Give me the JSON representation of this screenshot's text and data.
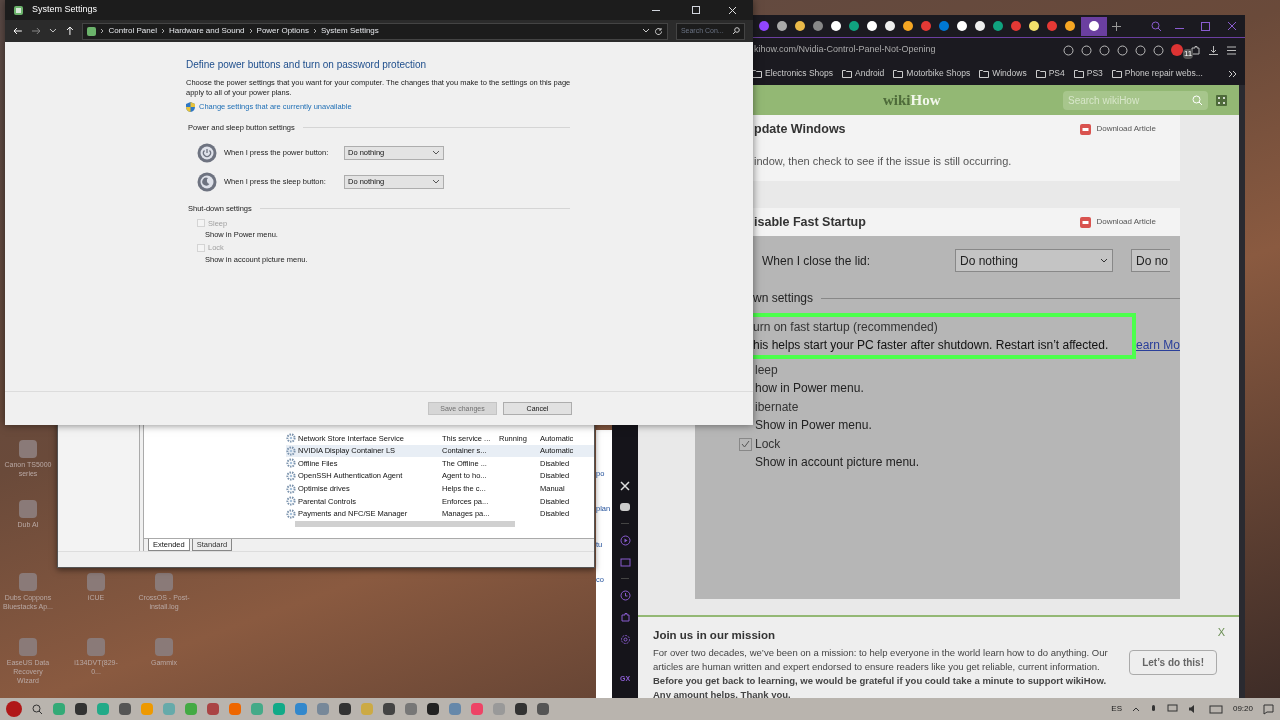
{
  "desktop_icons": [
    {
      "label": "Canon TS5000 series"
    },
    {
      "label": "Dub AI"
    },
    {
      "label": "Dubs Coppons Bluestacks Ap..."
    },
    {
      "label": "iCUE"
    },
    {
      "label": "CrossOS - Post-install.log"
    },
    {
      "label": "EaseUS Data Recovery Wizard"
    },
    {
      "label": "i134DVT(829-0..."
    },
    {
      "label": "Gammix"
    }
  ],
  "services_window": {
    "rows": [
      {
        "cells": [
          "Network Store Interface Service",
          "This service ...",
          "Running",
          "Automatic"
        ],
        "selected": false
      },
      {
        "cells": [
          "NVIDIA Display Container LS",
          "Container s...",
          "",
          "Automatic"
        ],
        "selected": true
      },
      {
        "cells": [
          "Offline Files",
          "The Offline ...",
          "",
          "Disabled"
        ],
        "selected": false
      },
      {
        "cells": [
          "OpenSSH Authentication Agent",
          "Agent to ho...",
          "",
          "Disabled"
        ],
        "selected": false
      },
      {
        "cells": [
          "Optimise drives",
          "Helps the c...",
          "",
          "Manual"
        ],
        "selected": false
      },
      {
        "cells": [
          "Parental Controls",
          "Enforces pa...",
          "",
          "Disabled"
        ],
        "selected": false
      },
      {
        "cells": [
          "Payments and NFC/SE Manager",
          "Manages pa...",
          "",
          "Disabled"
        ],
        "selected": false
      }
    ],
    "tabs": [
      {
        "label": "Extended",
        "selected": true
      },
      {
        "label": "Standard",
        "selected": false
      }
    ]
  },
  "background_window_fragments": [
    "po",
    "plan",
    "tu",
    "co"
  ],
  "browser": {
    "tabs": [
      {
        "selected": false
      },
      {
        "selected": false
      },
      {
        "selected": false
      },
      {
        "selected": false
      },
      {
        "selected": false
      },
      {
        "selected": false
      },
      {
        "selected": false
      },
      {
        "selected": false
      },
      {
        "selected": false
      },
      {
        "selected": false
      },
      {
        "selected": false
      },
      {
        "selected": false
      },
      {
        "selected": false
      },
      {
        "selected": false
      },
      {
        "selected": false
      },
      {
        "selected": false
      },
      {
        "selected": false
      },
      {
        "selected": false
      },
      {
        "selected": true
      }
    ],
    "url": "kihow.com/Nvidia-Control-Panel-Not-Opening",
    "extension_badge": "11",
    "bookmarks": [
      "Electronics Shops",
      "Android",
      "Motorbike Shops",
      "Windows",
      "PS4",
      "PS3",
      "Phone repair webs..."
    ],
    "sidebar_label": "GX",
    "page": {
      "logo": {
        "left": "wiki",
        "right": "How"
      },
      "search_placeholder": "Search wikiHow",
      "sections": [
        {
          "title": "pdate Windows",
          "download": "Download Article",
          "text": "indow, then check to see if the issue is still occurring."
        },
        {
          "title": "isable Fast Startup",
          "download": "Download Article"
        }
      ],
      "screenshot": {
        "lid_label": "When I close the lid:",
        "lid_value": "Do nothing",
        "lid_value_2": "Do no",
        "group": "wn settings",
        "highlight_title": "urn on fast startup (recommended)",
        "highlight_text": "his helps start your PC faster after shutdown. Restart isn’t affected.",
        "learn_more": "earn Mo",
        "options": [
          {
            "label": "leep",
            "sub": "how in Power menu.",
            "kind": "cut"
          },
          {
            "label": "ibernate",
            "sub": "Show in Power menu.",
            "kind": "cut"
          },
          {
            "label": "Lock",
            "sub": "Show in account picture menu.",
            "kind": "checkbox",
            "checked": true
          }
        ]
      },
      "banner": {
        "title": "Join us in our mission",
        "text": "For over two decades, we’ve been on a mission: to help everyone in the world learn how to do anything. Our articles are human written and expert endorsed to ensure readers like you get reliable, current information. **Before you get back to learning, we would be grateful if you could take a minute to support wikiHow. Any amount helps. Thank you.**",
        "button": "Let’s do this!",
        "close": "X"
      }
    }
  },
  "settings_window": {
    "title": "System Settings",
    "breadcrumbs": [
      "Control Panel",
      "Hardware and Sound",
      "Power Options",
      "System Settings"
    ],
    "search_placeholder": "Search Con...",
    "heading": "Define power buttons and turn on password protection",
    "description": "Choose the power settings that you want for your computer. The changes that you make to the settings on this page apply to all of your power plans.",
    "admin_link": "Change settings that are currently unavailable",
    "button_group": "Power and sleep button settings",
    "button_rows": [
      {
        "label": "When I press the power button:",
        "value": "Do nothing",
        "kind": "power"
      },
      {
        "label": "When I press the sleep button:",
        "value": "Do nothing",
        "kind": "sleep"
      }
    ],
    "shutdown_group": "Shut-down settings",
    "shutdown_options": [
      {
        "label": "Sleep",
        "sub": "Show in Power menu.",
        "checked": false,
        "disabled": true
      },
      {
        "label": "Lock",
        "sub": "Show in account picture menu.",
        "checked": false,
        "disabled": true
      }
    ],
    "buttons": [
      {
        "label": "Save changes",
        "disabled": true
      },
      {
        "label": "Cancel",
        "disabled": false
      }
    ]
  },
  "taskbar": {
    "language": "ES",
    "time": "09:20"
  }
}
